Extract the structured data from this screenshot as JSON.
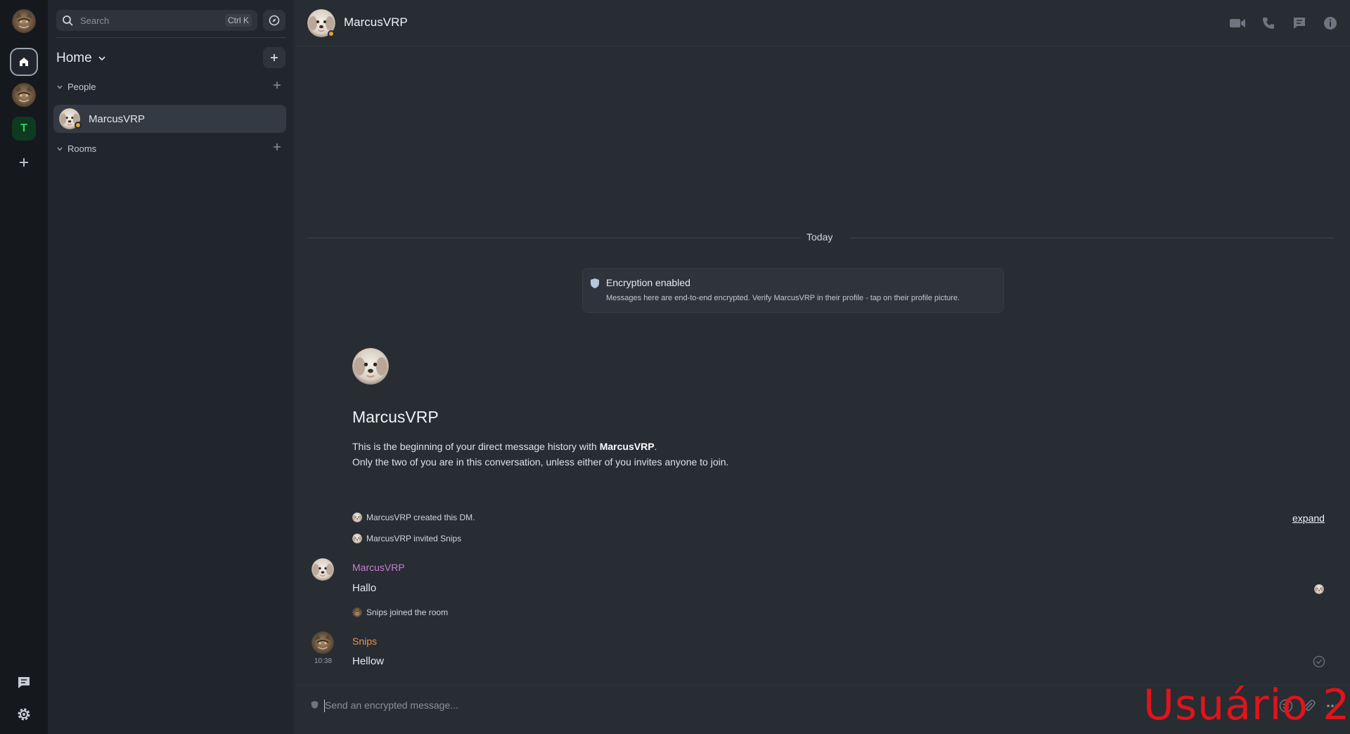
{
  "search": {
    "placeholder": "Search",
    "shortcut": "Ctrl K"
  },
  "home": {
    "title": "Home"
  },
  "sections": {
    "people": {
      "label": "People"
    },
    "rooms": {
      "label": "Rooms"
    }
  },
  "people": [
    {
      "name": "MarcusVRP"
    }
  ],
  "spaces": {
    "t_label": "T"
  },
  "header": {
    "title": "MarcusVRP"
  },
  "timeline": {
    "day": "Today",
    "encryption": {
      "title": "Encryption enabled",
      "desc": "Messages here are end-to-end encrypted. Verify MarcusVRP in their profile - tap on their profile picture."
    },
    "intro": {
      "name": "MarcusVRP",
      "line1_pre": "This is the beginning of your direct message history with ",
      "line1_bold": "MarcusVRP",
      "line1_post": ".",
      "line2": "Only the two of you are in this conversation, unless either of you invites anyone to join."
    },
    "events": {
      "created": "MarcusVRP created this DM.",
      "invited": "MarcusVRP invited Snips",
      "joined": "Snips joined the room",
      "expand": "expand"
    },
    "messages": [
      {
        "sender": "MarcusVRP",
        "body": "Hallo",
        "color": "#c77dd6"
      },
      {
        "sender": "Snips",
        "body": "Hellow",
        "time": "10:38",
        "color": "#e8934d"
      }
    ]
  },
  "composer": {
    "placeholder": "Send an encrypted message..."
  },
  "overlay": {
    "watermark": "Usuário 2"
  },
  "colors": {
    "presence": "#e0a43b",
    "watermark": "#e0141a"
  },
  "icons": [
    "search-icon",
    "compass-icon",
    "home-icon",
    "plus-icon",
    "chevron-down-icon",
    "video-call-icon",
    "voice-call-icon",
    "threads-icon",
    "info-icon",
    "shield-icon",
    "emoji-icon",
    "attachment-icon",
    "more-options-icon",
    "chat-bubble-icon",
    "settings-gear-icon",
    "read-receipt-icon",
    "sent-check-icon"
  ]
}
